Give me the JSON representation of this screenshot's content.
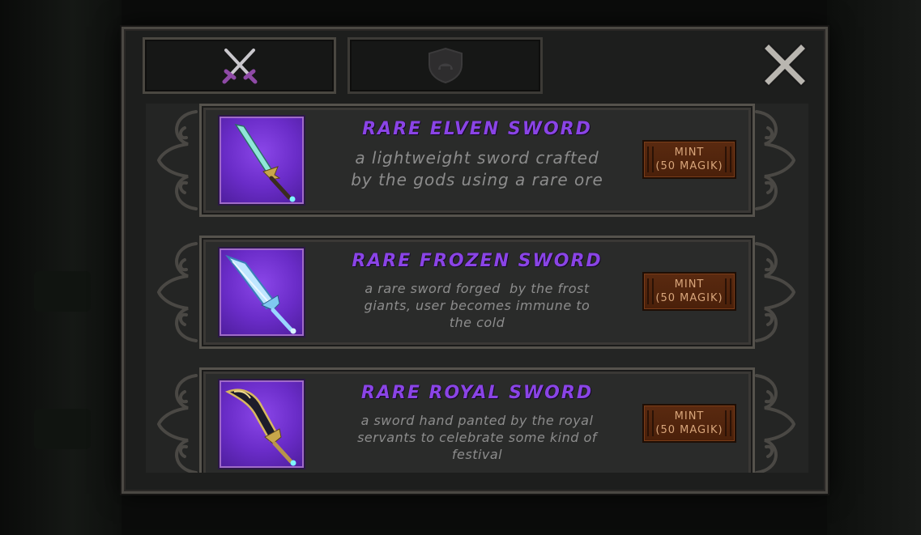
{
  "tabs": [
    {
      "icon": "crossed-swords-icon",
      "active": true
    },
    {
      "icon": "shield-helmet-icon",
      "active": false
    }
  ],
  "close": {
    "icon": "close-icon"
  },
  "colors": {
    "title": "#8a44e6",
    "description": "#8c8c8c",
    "button_bg": "#4f240c",
    "button_text": "#d8a57a",
    "thumb_bg": "#6a2cc8"
  },
  "items": [
    {
      "title": "RARE ELVEN SWORD",
      "description": [
        "a lightweight sword crafted",
        "by the gods using a rare ore"
      ],
      "icon": "elven-sword-icon",
      "button": {
        "line1": "MINT",
        "line2": "(50 MAGIK)"
      }
    },
    {
      "title": "RARE FROZEN SWORD",
      "description": [
        "a rare sword forged  by the frost",
        "giants, user becomes immune to",
        "the cold"
      ],
      "icon": "frozen-sword-icon",
      "button": {
        "line1": "MINT",
        "line2": "(50 MAGIK)"
      }
    },
    {
      "title": "RARE ROYAL SWORD",
      "description": [
        "a sword hand panted by the royal",
        "servants to celebrate some kind of",
        "festival"
      ],
      "icon": "royal-sword-icon",
      "button": {
        "line1": "MINT",
        "line2": "(50 MAGIK)"
      }
    }
  ]
}
